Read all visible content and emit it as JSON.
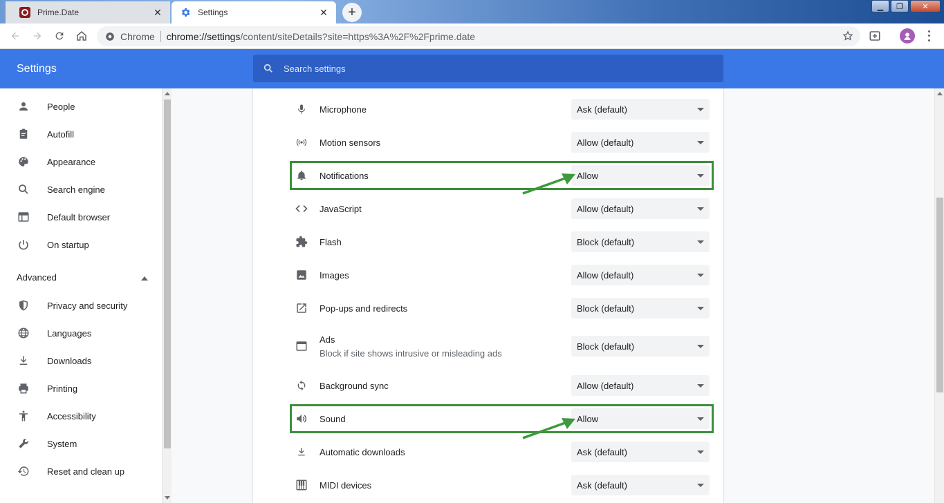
{
  "tabs": [
    {
      "title": "Prime.Date",
      "active": false
    },
    {
      "title": "Settings",
      "active": true
    }
  ],
  "omnibox": {
    "chip": "Chrome",
    "url_host": "chrome://settings",
    "url_path": "/content/siteDetails?site=https%3A%2F%2Fprime.date"
  },
  "header": {
    "title": "Settings",
    "search_placeholder": "Search settings"
  },
  "sidebar": {
    "items": [
      {
        "label": "People",
        "icon": "person-icon"
      },
      {
        "label": "Autofill",
        "icon": "clipboard-icon"
      },
      {
        "label": "Appearance",
        "icon": "palette-icon"
      },
      {
        "label": "Search engine",
        "icon": "search-icon"
      },
      {
        "label": "Default browser",
        "icon": "browser-icon"
      },
      {
        "label": "On startup",
        "icon": "power-icon"
      }
    ],
    "advanced_label": "Advanced",
    "advanced_items": [
      {
        "label": "Privacy and security",
        "icon": "shield-icon"
      },
      {
        "label": "Languages",
        "icon": "globe-icon"
      },
      {
        "label": "Downloads",
        "icon": "download-icon"
      },
      {
        "label": "Printing",
        "icon": "printer-icon"
      },
      {
        "label": "Accessibility",
        "icon": "accessibility-icon"
      },
      {
        "label": "System",
        "icon": "wrench-icon"
      },
      {
        "label": "Reset and clean up",
        "icon": "restore-icon"
      }
    ]
  },
  "permissions": [
    {
      "label": "Microphone",
      "value": "Ask (default)",
      "icon": "microphone-icon",
      "highlighted": false
    },
    {
      "label": "Motion sensors",
      "value": "Allow (default)",
      "icon": "sensors-icon",
      "highlighted": false
    },
    {
      "label": "Notifications",
      "value": "Allow",
      "icon": "bell-icon",
      "highlighted": true
    },
    {
      "label": "JavaScript",
      "value": "Allow (default)",
      "icon": "code-icon",
      "highlighted": false
    },
    {
      "label": "Flash",
      "value": "Block (default)",
      "icon": "puzzle-icon",
      "highlighted": false
    },
    {
      "label": "Images",
      "value": "Allow (default)",
      "icon": "image-icon",
      "highlighted": false
    },
    {
      "label": "Pop-ups and redirects",
      "value": "Block (default)",
      "icon": "open-external-icon",
      "highlighted": false
    },
    {
      "label": "Ads",
      "sublabel": "Block if site shows intrusive or misleading ads",
      "value": "Block (default)",
      "icon": "window-icon",
      "highlighted": false
    },
    {
      "label": "Background sync",
      "value": "Allow (default)",
      "icon": "sync-icon",
      "highlighted": false
    },
    {
      "label": "Sound",
      "value": "Allow",
      "icon": "speaker-icon",
      "highlighted": true
    },
    {
      "label": "Automatic downloads",
      "value": "Ask (default)",
      "icon": "download-icon",
      "highlighted": false
    },
    {
      "label": "MIDI devices",
      "value": "Ask (default)",
      "icon": "piano-icon",
      "highlighted": false
    }
  ],
  "colors": {
    "header_blue": "#3b78e7",
    "highlight_green": "#3c8f3c"
  }
}
